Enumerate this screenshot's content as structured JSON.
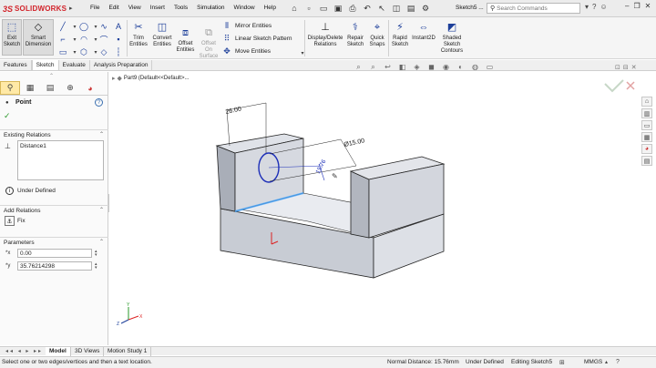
{
  "app": {
    "brand_ds": "3S",
    "brand_sw": "SOLIDWORKS",
    "doc_title": "Sketch5 ..."
  },
  "menu": [
    "File",
    "Edit",
    "View",
    "Insert",
    "Tools",
    "Simulation",
    "Window",
    "Help"
  ],
  "search": {
    "placeholder": "Search Commands"
  },
  "ribbon": {
    "exit_sketch": "Exit\nSketch",
    "smart_dimension": "Smart\nDimension",
    "trim": "Trim\nEntities",
    "convert": "Convert\nEntities",
    "offset": "Offset\nEntities",
    "offset_surface": "Offset\nOn\nSurface",
    "mirror": "Mirror Entities",
    "linear_pattern": "Linear Sketch Pattern",
    "move": "Move Entities",
    "display_delete": "Display/Delete\nRelations",
    "repair": "Repair\nSketch",
    "quick_snaps": "Quick\nSnaps",
    "rapid_sketch": "Rapid\nSketch",
    "instant2d": "Instant2D",
    "shaded_contours": "Shaded\nSketch\nContours"
  },
  "tabs": [
    "Features",
    "Sketch",
    "Evaluate",
    "Analysis Preparation"
  ],
  "active_tab": "Sketch",
  "tree": {
    "item": "Part9 (Default<<Default>..."
  },
  "property_manager": {
    "title": "Point",
    "existing_relations_label": "Existing Relations",
    "relations": [
      "Distance1"
    ],
    "status": "Under Defined",
    "add_relations_label": "Add Relations",
    "fix_label": "Fix",
    "parameters_label": "Parameters",
    "x_value": "0.00",
    "y_value": "35.76214298"
  },
  "model": {
    "dim_26": "26.00",
    "dim_15": "Ø15.00",
    "dim_15_76": "15.76"
  },
  "bottom_tabs": [
    "Model",
    "3D Views",
    "Motion Study 1"
  ],
  "status": {
    "hint": "Select one or two edges/vertices and then a text location.",
    "distance": "Normal Distance: 15.76mm",
    "defined": "Under Defined",
    "editing": "Editing Sketch5",
    "units": "MMGS"
  },
  "colors": {
    "accent": "#d2232a",
    "sketch_blue": "#1d2fb8",
    "face": "#c9cdd6"
  }
}
